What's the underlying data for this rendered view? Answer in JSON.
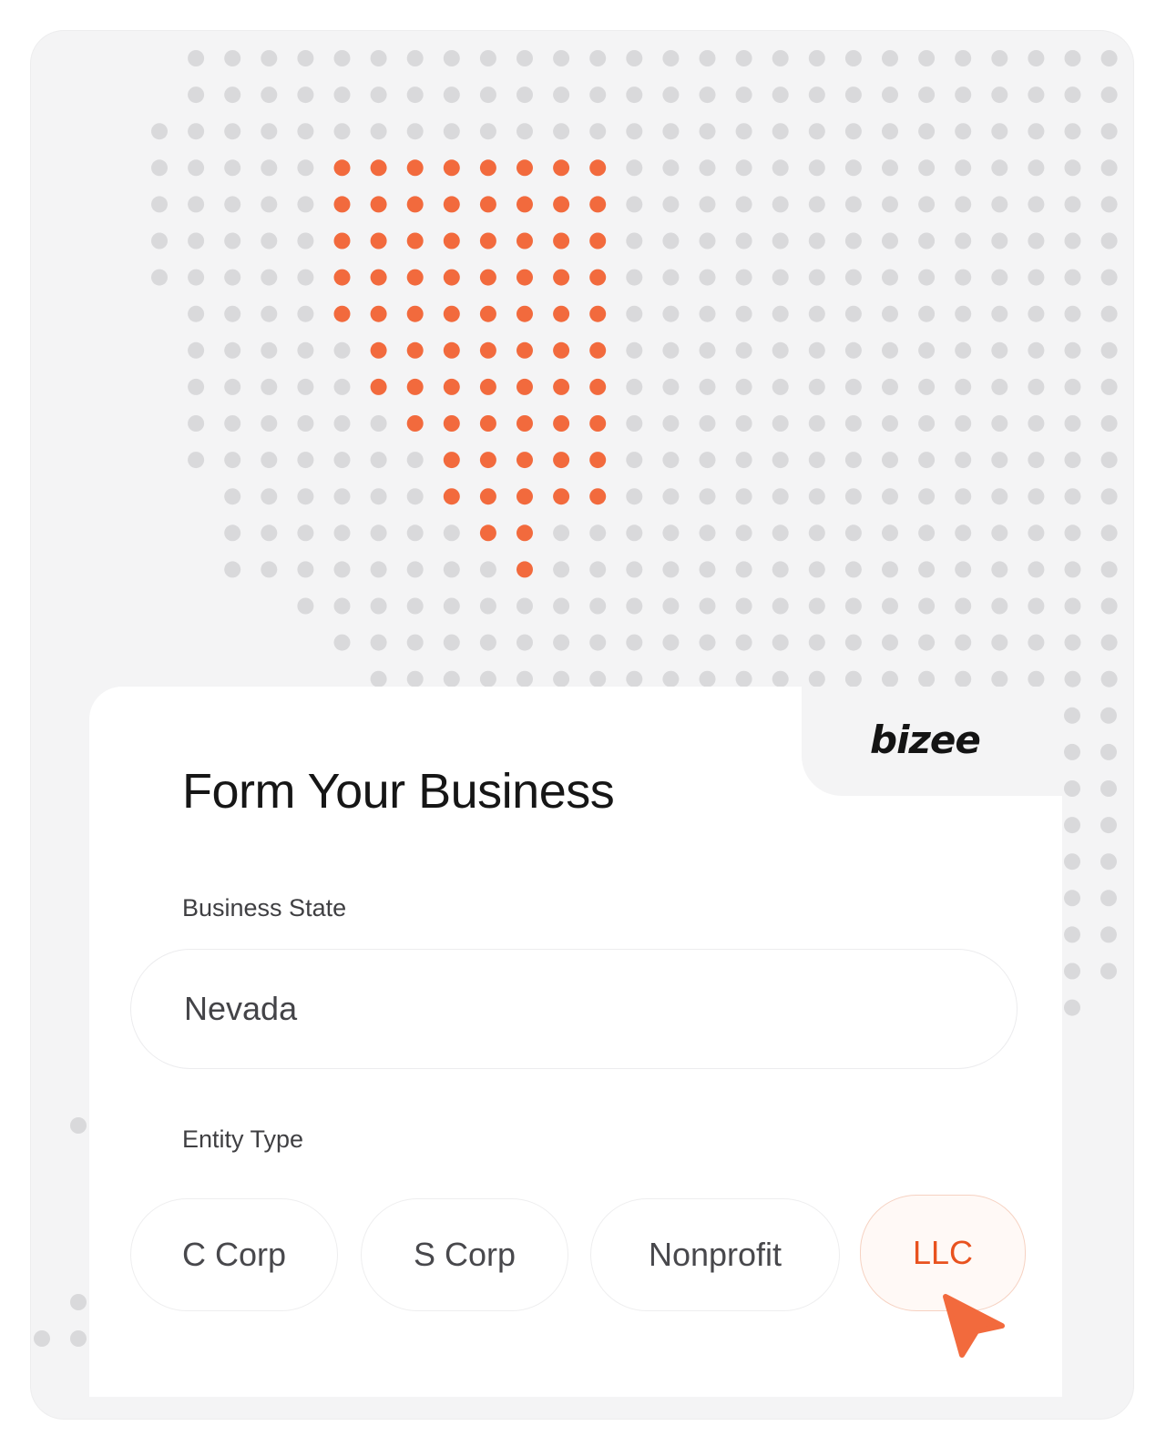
{
  "brand": {
    "logo_text": "bizee",
    "accent_color": "#f26a3d",
    "dot_color": "#d9d9db"
  },
  "map": {
    "highlighted_state": "Nevada"
  },
  "form": {
    "title": "Form Your Business",
    "state_label": "Business State",
    "state_value": "Nevada",
    "entity_label": "Entity Type",
    "entity_options": [
      {
        "label": "C Corp",
        "selected": false
      },
      {
        "label": "S Corp",
        "selected": false
      },
      {
        "label": "Nonprofit",
        "selected": false
      },
      {
        "label": "LLC",
        "selected": true
      }
    ]
  },
  "cursor": {
    "icon": "pointer-arrow-icon",
    "color": "#f26a3d"
  }
}
